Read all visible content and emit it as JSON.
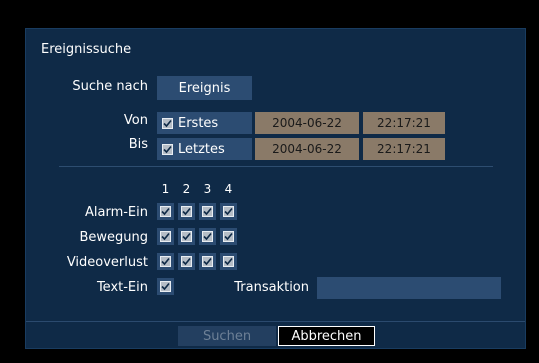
{
  "dialog": {
    "title": "Ereignissuche"
  },
  "search_by": {
    "label": "Suche nach",
    "value": "Ereignis"
  },
  "from": {
    "label": "Von",
    "checkbox_label": "Erstes",
    "checked": true,
    "date": "2004-06-22",
    "time": "22:17:21"
  },
  "to": {
    "label": "Bis",
    "checkbox_label": "Letztes",
    "checked": true,
    "date": "2004-06-22",
    "time": "22:17:21"
  },
  "columns": [
    "1",
    "2",
    "3",
    "4"
  ],
  "rows": [
    {
      "label": "Alarm-Ein",
      "checks": [
        true,
        true,
        true,
        true
      ]
    },
    {
      "label": "Bewegung",
      "checks": [
        true,
        true,
        true,
        true
      ]
    },
    {
      "label": "Videoverlust",
      "checks": [
        true,
        true,
        true,
        true
      ]
    }
  ],
  "text_in": {
    "label": "Text-Ein",
    "checked": true
  },
  "transaction": {
    "label": "Transaktion",
    "value": ""
  },
  "footer": {
    "search_label": "Suchen",
    "cancel_label": "Abbrechen"
  },
  "colors": {
    "panel": "#0f2a47",
    "field": "#2c4c72",
    "date_field": "#8a7a68"
  }
}
